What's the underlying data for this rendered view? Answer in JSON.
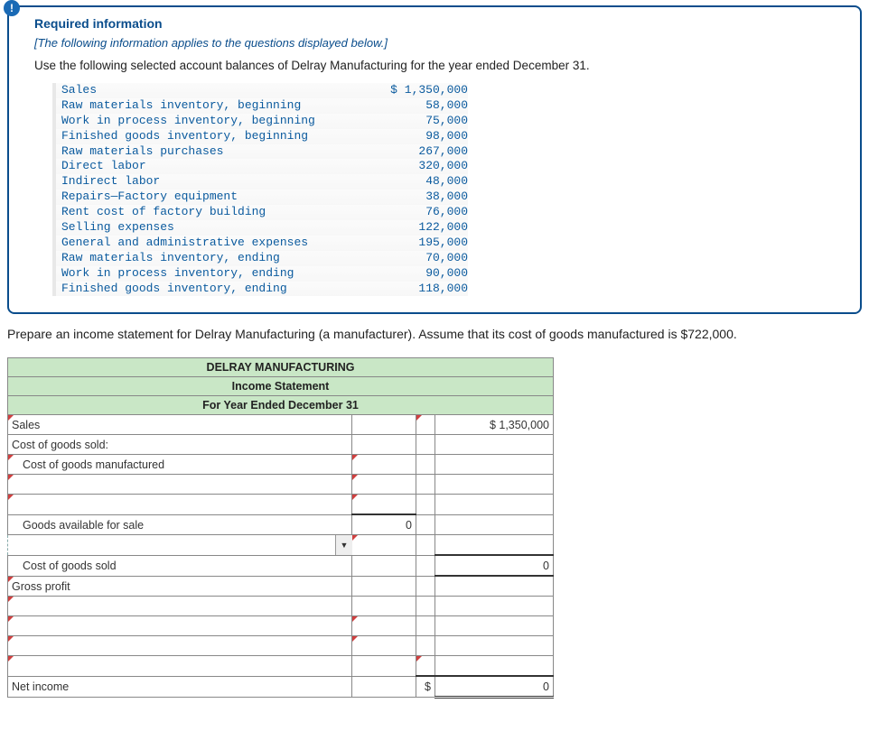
{
  "info": {
    "heading": "Required information",
    "subheading": "[The following information applies to the questions displayed below.]",
    "directive": "Use the following selected account balances of Delray Manufacturing for the year ended December 31.",
    "badge": "!"
  },
  "accounts": [
    {
      "label": "Sales",
      "value": "$ 1,350,000"
    },
    {
      "label": "Raw materials inventory, beginning",
      "value": "58,000"
    },
    {
      "label": "Work in process inventory, beginning",
      "value": "75,000"
    },
    {
      "label": "Finished goods inventory, beginning",
      "value": "98,000"
    },
    {
      "label": "Raw materials purchases",
      "value": "267,000"
    },
    {
      "label": "Direct labor",
      "value": "320,000"
    },
    {
      "label": "Indirect labor",
      "value": "48,000"
    },
    {
      "label": "Repairs—Factory equipment",
      "value": "38,000"
    },
    {
      "label": "Rent cost of factory building",
      "value": "76,000"
    },
    {
      "label": "Selling expenses",
      "value": "122,000"
    },
    {
      "label": "General and administrative expenses",
      "value": "195,000"
    },
    {
      "label": "Raw materials inventory, ending",
      "value": "70,000"
    },
    {
      "label": "Work in process inventory, ending",
      "value": "90,000"
    },
    {
      "label": "Finished goods inventory, ending",
      "value": "118,000"
    }
  ],
  "question": "Prepare an income statement for Delray Manufacturing (a manufacturer). Assume that its cost of goods manufactured is $722,000.",
  "ws": {
    "title1": "DELRAY MANUFACTURING",
    "title2": "Income Statement",
    "title3": "For Year Ended December 31",
    "sales": "Sales",
    "sales_val": "$  1,350,000",
    "cogs_hdr": "Cost of goods sold:",
    "cogm": "Cost of goods manufactured",
    "gafs": "Goods available for sale",
    "gafs_val": "0",
    "cogs": "Cost of goods sold",
    "cogs_val": "0",
    "gp": "Gross profit",
    "ni": "Net income",
    "ni_sym": "$",
    "ni_val": "0"
  }
}
